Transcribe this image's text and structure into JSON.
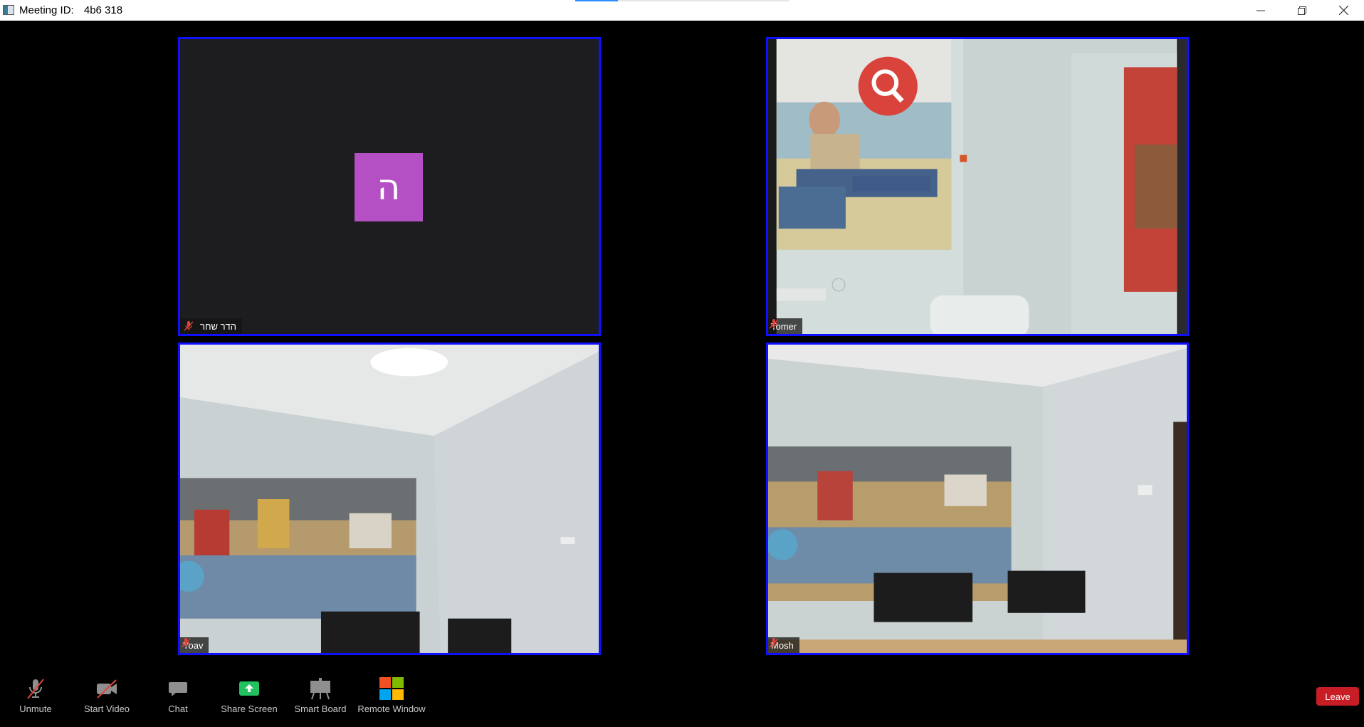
{
  "window": {
    "title_label": "Meeting ID:",
    "meeting_id": "4b6 318",
    "controls": [
      "minimize",
      "restore",
      "close"
    ]
  },
  "participants": [
    {
      "name": "הדר שחר",
      "avatar_initial": "ה",
      "video": "off",
      "muted": true,
      "avatar_color": "#b44fc4"
    },
    {
      "name": "Tomer",
      "video": "on",
      "muted": true
    },
    {
      "name": "Yoav",
      "video": "on",
      "muted": true
    },
    {
      "name": "Mosh",
      "video": "on",
      "muted": true
    }
  ],
  "toolbar": {
    "unmute": "Unmute",
    "start_video": "Start Video",
    "chat": "Chat",
    "share_screen": "Share Screen",
    "smart_board": "Smart Board",
    "remote_window": "Remote Window",
    "leave": "Leave"
  },
  "colors": {
    "tile_border": "#1010ff",
    "leave_button": "#c81d25",
    "share_screen_icon": "#22c35e",
    "muted_icon": "#e0453a"
  }
}
